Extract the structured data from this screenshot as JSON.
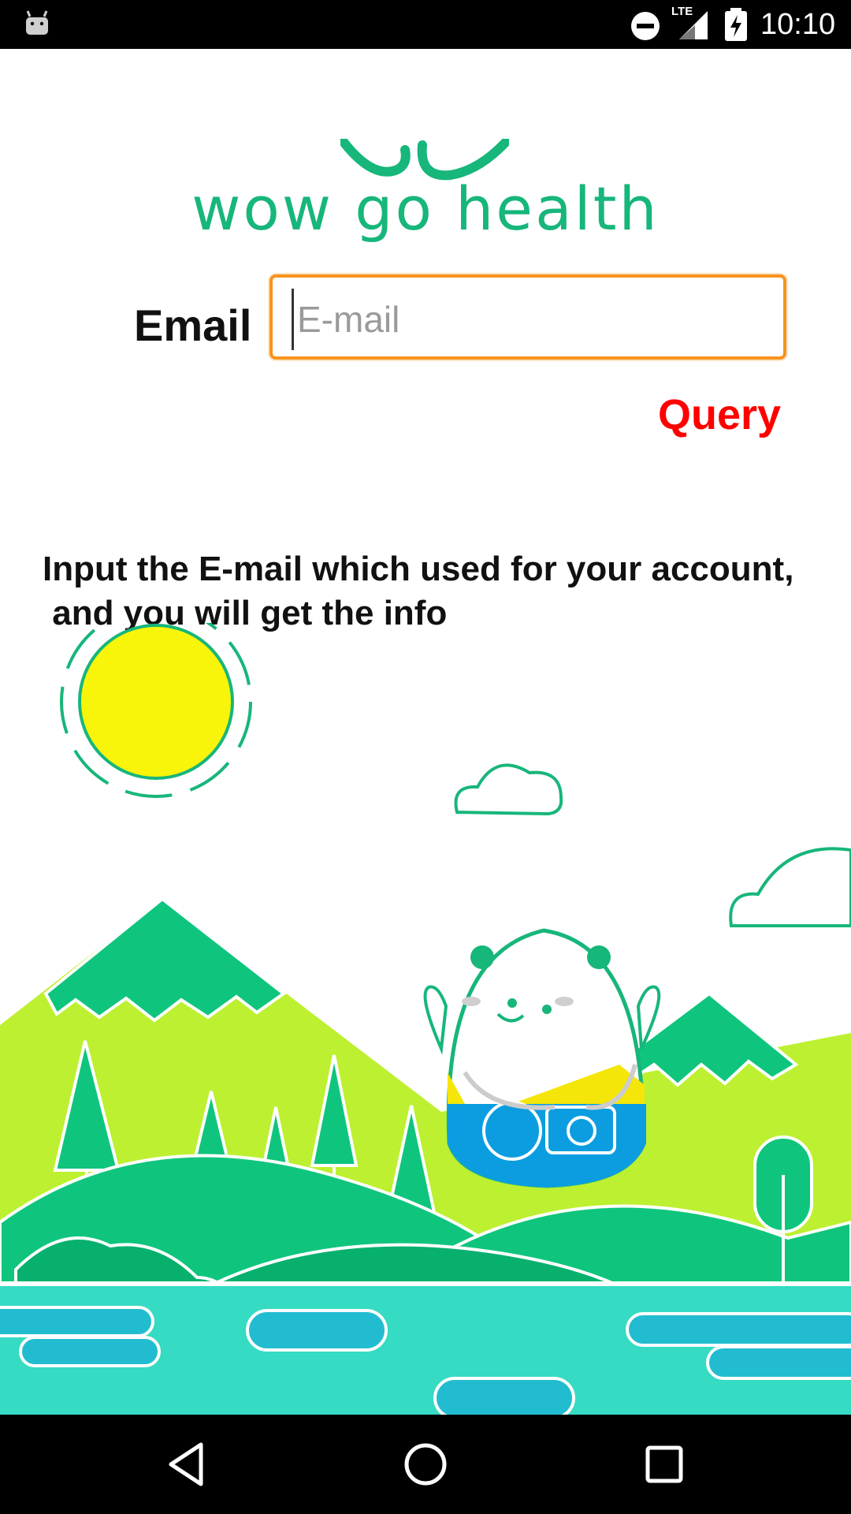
{
  "status_bar": {
    "time": "10:10",
    "network": "LTE",
    "icons": [
      "android-debug-icon",
      "do-not-disturb-icon",
      "lte-signal-icon",
      "battery-charging-icon"
    ]
  },
  "logo": {
    "text": "wow go health",
    "color": "#17b67a"
  },
  "form": {
    "email_label": "Email",
    "email_placeholder": "E-mail",
    "email_value": "",
    "query_label": "Query",
    "accent_color": "#f7931e",
    "query_color": "#ff0000"
  },
  "info": {
    "message": "Input the E-mail which used for your account,\n and you will get the info"
  },
  "nav_bar": {
    "icons": [
      "back-icon",
      "home-icon",
      "recents-icon"
    ]
  }
}
